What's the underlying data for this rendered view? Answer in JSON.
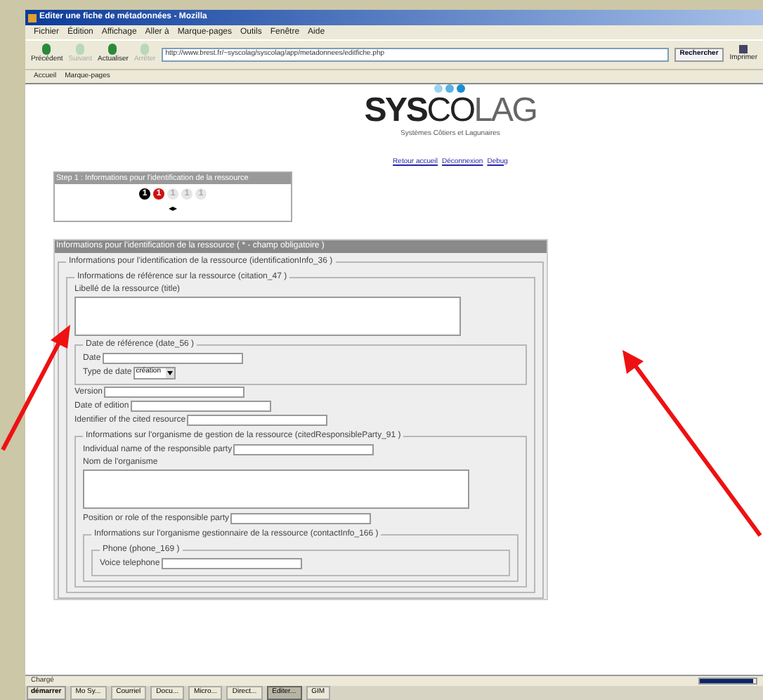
{
  "window": {
    "title": "Editer une fiche de métadonnées - Mozilla"
  },
  "menu": [
    "Fichier",
    "Édition",
    "Affichage",
    "Aller à",
    "Marque-pages",
    "Outils",
    "Fenêtre",
    "Aide"
  ],
  "toolbar": {
    "buttons": [
      {
        "label": "Précédent",
        "disabled": false
      },
      {
        "label": "Suivant",
        "disabled": true
      },
      {
        "label": "Actualiser",
        "disabled": false
      },
      {
        "label": "Arrêter",
        "disabled": true
      }
    ],
    "url": "http://www.brest.fr/~syscolag/syscolag/app/metadonnees/editfiche.php",
    "search": "Rechercher",
    "print": "Imprimer"
  },
  "bookmarks": [
    "Accueil",
    "Marque-pages"
  ],
  "logo": {
    "main": "**SYS**CO",
    "light": "LAG",
    "tagline": "Systèmes Côtiers et Lagunaires"
  },
  "nav_links": [
    "Retour accueil",
    "Déconnexion",
    "Debug"
  ],
  "step": {
    "title": "Step 1 : Informations pour l'identification de la ressource",
    "steps": [
      {
        "label": "1",
        "color": "#000000"
      },
      {
        "label": "1",
        "color": "#cc1111"
      },
      {
        "label": "1",
        "color": "#e6e6e6"
      },
      {
        "label": "1",
        "color": "#e6e6e6"
      },
      {
        "label": "1",
        "color": "#e6e6e6"
      }
    ],
    "pager": "◂▸"
  },
  "form": {
    "header": "Informations pour l'identification de la ressource ( * - champ obligatoire )",
    "items": [
      {
        "kind": "fieldset",
        "legend": "Informations pour l'identification de la ressource (identificationInfo_36 )",
        "children": [
          {
            "kind": "fieldset",
            "legend": "Informations de référence sur la ressource (citation_47 )",
            "children": [
              {
                "kind": "textarea",
                "label": "Libellé de la ressource (title)"
              },
              {
                "kind": "fieldset",
                "legend": "Date de référence (date_56 )",
                "children": [
                  {
                    "kind": "input",
                    "label": "Date"
                  },
                  {
                    "kind": "select",
                    "label": "Type de date",
                    "value": "création"
                  }
                ]
              },
              {
                "kind": "input",
                "label": "Version"
              },
              {
                "kind": "input",
                "label": "Date of edition"
              },
              {
                "kind": "input",
                "label": "Identifier of the cited resource"
              },
              {
                "kind": "fieldset",
                "legend": "Informations sur l'organisme de gestion de la ressource (citedResponsibleParty_91 )",
                "children": [
                  {
                    "kind": "input",
                    "label": "Individual name of the responsible party"
                  },
                  {
                    "kind": "textarea",
                    "label": "Nom de l'organisme"
                  },
                  {
                    "kind": "input",
                    "label": "Position or role of the responsible party"
                  },
                  {
                    "kind": "fieldset",
                    "legend": "Informations sur l'organisme gestionnaire de la ressource (contactInfo_166 )",
                    "children": [
                      {
                        "kind": "fieldset",
                        "legend": "Phone (phone_169 )",
                        "children": [
                          {
                            "kind": "input",
                            "label": "Voice telephone"
                          }
                        ]
                      }
                    ]
                  }
                ]
              }
            ]
          }
        ]
      }
    ]
  },
  "status_bar": {
    "text": "Chargé",
    "level": 0.95
  },
  "taskbar": {
    "start": "démarrer",
    "tasks": [
      {
        "label": "Mo Sy...",
        "selected": false
      },
      {
        "label": "Courriel",
        "selected": false
      },
      {
        "label": "Docu...",
        "selected": false
      },
      {
        "label": "Micro...",
        "selected": false
      },
      {
        "label": "Direct...",
        "selected": false
      },
      {
        "label": "Editer...",
        "selected": true
      },
      {
        "label": "GIM",
        "selected": false
      }
    ]
  }
}
